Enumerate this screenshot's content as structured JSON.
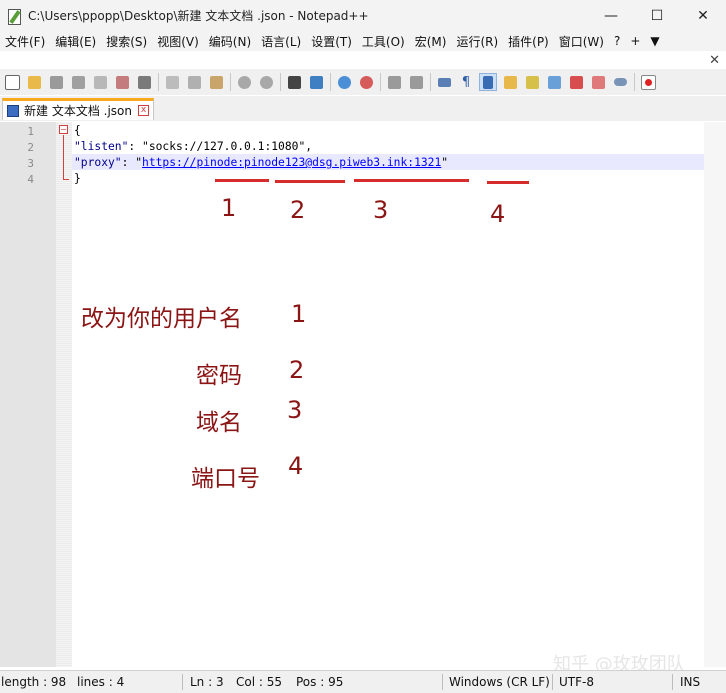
{
  "window": {
    "title": "C:\\Users\\ppopp\\Desktop\\新建 文本文档 .json - Notepad++",
    "minimize": "—",
    "maximize": "☐",
    "close": "✕"
  },
  "menu": [
    "文件(F)",
    "编辑(E)",
    "搜索(S)",
    "视图(V)",
    "编码(N)",
    "语言(L)",
    "设置(T)",
    "工具(O)",
    "宏(M)",
    "运行(R)",
    "插件(P)",
    "窗口(W)",
    "?",
    "+",
    "▼"
  ],
  "menu_close": "✕",
  "tab": {
    "name": "新建 文本文档 .json",
    "close": "x"
  },
  "editor": {
    "line_numbers": [
      "1",
      "2",
      "3",
      "4"
    ],
    "lines": {
      "l1": "{",
      "l2_key": "\"listen\"",
      "l2_colon": ": ",
      "l2_val": "\"socks://127.0.0.1:1080\"",
      "l2_comma": ",",
      "l3_key": "\"proxy\"",
      "l3_colon": ": ",
      "l3_q1": "\"",
      "l3_url": "https://pinode:pinode123@dsg.piweb3.ink:1321",
      "l3_q2": "\"",
      "l4": "}"
    },
    "fold_symbol": "−"
  },
  "annotations": {
    "marks": [
      "1",
      "2",
      "3",
      "4"
    ],
    "legend": [
      {
        "label": "改为你的用户名",
        "num": "1"
      },
      {
        "label": "密码",
        "num": "2"
      },
      {
        "label": "域名",
        "num": "3"
      },
      {
        "label": "端口号",
        "num": "4"
      }
    ],
    "color": "#8b1414",
    "underline_color": "#d82b2b"
  },
  "watermark": "知乎 @玫玫团队",
  "status": {
    "length": "length : 98",
    "lines": "lines : 4",
    "ln": "Ln : 3",
    "col": "Col : 55",
    "pos": "Pos : 95",
    "eol": "Windows (CR LF)",
    "encoding": "UTF-8",
    "mode": "INS"
  },
  "toolbar_icons": [
    "new-file-icon",
    "open-file-icon",
    "save-icon",
    "save-all-icon",
    "close-icon",
    "close-all-icon",
    "print-icon",
    "cut-icon",
    "copy-icon",
    "paste-icon",
    "undo-icon",
    "redo-icon",
    "find-icon",
    "replace-icon",
    "zoom-in-icon",
    "zoom-out-icon",
    "sync-vertical-icon",
    "sync-horizontal-icon",
    "word-wrap-icon",
    "show-all-chars-icon",
    "indent-guide-icon",
    "user-defined-lang-icon",
    "doc-map-icon",
    "function-list-icon",
    "folder-workspace-icon",
    "monitoring-icon",
    "record-macro-icon"
  ]
}
